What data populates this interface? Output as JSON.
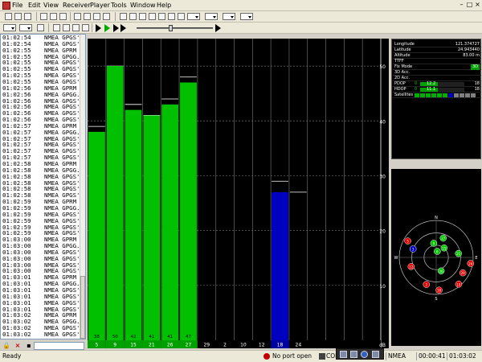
{
  "app": {
    "menu": [
      "File",
      "Edit",
      "View",
      "Receiver",
      "Player",
      "Tools",
      "Window",
      "Help"
    ],
    "window_controls": [
      "–",
      "□",
      "×"
    ]
  },
  "log": {
    "lines": [
      [
        "01:02:54",
        "NMEA GPGS'"
      ],
      [
        "01:02:54",
        "NMEA GPGS'"
      ],
      [
        "01:02:55",
        "NMEA GPRM"
      ],
      [
        "01:02:55",
        "NMEA GPGG."
      ],
      [
        "01:02:55",
        "NMEA GPGS'"
      ],
      [
        "01:02:55",
        "NMEA GPGS'"
      ],
      [
        "01:02:55",
        "NMEA GPGS'"
      ],
      [
        "01:02:55",
        "NMEA GPGS'"
      ],
      [
        "01:02:56",
        "NMEA GPRM"
      ],
      [
        "01:02:56",
        "NMEA GPGG."
      ],
      [
        "01:02:56",
        "NMEA GPGS'"
      ],
      [
        "01:02:56",
        "NMEA GPGS'"
      ],
      [
        "01:02:56",
        "NMEA GPGS'"
      ],
      [
        "01:02:56",
        "NMEA GPGS'"
      ],
      [
        "01:02:57",
        "NMEA GPRM"
      ],
      [
        "01:02:57",
        "NMEA GPGG."
      ],
      [
        "01:02:57",
        "NMEA GPGS'"
      ],
      [
        "01:02:57",
        "NMEA GPGS'"
      ],
      [
        "01:02:57",
        "NMEA GPGS'"
      ],
      [
        "01:02:57",
        "NMEA GPGS'"
      ],
      [
        "01:02:58",
        "NMEA GPRM"
      ],
      [
        "01:02:58",
        "NMEA GPGG."
      ],
      [
        "01:02:58",
        "NMEA GPGS'"
      ],
      [
        "01:02:58",
        "NMEA GPGS'"
      ],
      [
        "01:02:58",
        "NMEA GPGS'"
      ],
      [
        "01:02:58",
        "NMEA GPGS'"
      ],
      [
        "01:02:59",
        "NMEA GPRM"
      ],
      [
        "01:02:59",
        "NMEA GPGG."
      ],
      [
        "01:02:59",
        "NMEA GPGS'"
      ],
      [
        "01:02:59",
        "NMEA GPGS'"
      ],
      [
        "01:02:59",
        "NMEA GPGS'"
      ],
      [
        "01:02:59",
        "NMEA GPGS'"
      ],
      [
        "01:03:00",
        "NMEA GPRM"
      ],
      [
        "01:03:00",
        "NMEA GPGG."
      ],
      [
        "01:03:00",
        "NMEA GPGS'"
      ],
      [
        "01:03:00",
        "NMEA GPGS'"
      ],
      [
        "01:03:00",
        "NMEA GPGS'"
      ],
      [
        "01:03:00",
        "NMEA GPGS'"
      ],
      [
        "01:03:01",
        "NMEA GPRM"
      ],
      [
        "01:03:01",
        "NMEA GPGG."
      ],
      [
        "01:03:01",
        "NMEA GPGS'"
      ],
      [
        "01:03:01",
        "NMEA GPGS'"
      ],
      [
        "01:03:01",
        "NMEA GPGS'"
      ],
      [
        "01:03:01",
        "NMEA GPGS'"
      ],
      [
        "01:03:02",
        "NMEA GPRM"
      ],
      [
        "01:03:02",
        "NMEA GPGG."
      ],
      [
        "01:03:02",
        "NMEA GPGS'"
      ],
      [
        "01:03:02",
        "NMEA GPGS'"
      ]
    ]
  },
  "chart_data": {
    "type": "bar",
    "ylabel": "dB",
    "ylim": [
      0,
      55
    ],
    "yticks": [
      10,
      20,
      30,
      40,
      50
    ],
    "categories": [
      "5",
      "9",
      "15",
      "21",
      "26",
      "27",
      "29",
      "2",
      "10",
      "12",
      "18",
      "24",
      "",
      "",
      "",
      ""
    ],
    "values": [
      38,
      50,
      42,
      41,
      43,
      47,
      null,
      null,
      null,
      null,
      27,
      null,
      null,
      null,
      null,
      null
    ],
    "peaks": [
      39,
      50,
      43,
      41,
      44,
      48,
      null,
      null,
      null,
      null,
      29,
      27,
      null,
      null,
      null,
      null
    ],
    "value_labels": [
      "38",
      "50",
      "42",
      "41",
      "41",
      "47",
      "",
      "",
      "",
      "",
      "",
      "",
      "",
      "",
      "",
      ""
    ],
    "colors": {
      "used": "#00c000",
      "tracked": "#0000c0",
      "grid": "#6a6a6a",
      "axis_text": "#ffffff"
    },
    "in_use": [
      true,
      true,
      true,
      true,
      true,
      true,
      false,
      false,
      false,
      false,
      false,
      false,
      false,
      false,
      false,
      false
    ]
  },
  "info": {
    "rows": [
      {
        "label": "Longitude",
        "value": "121.374727"
      },
      {
        "label": "Latitude",
        "value": "24.943440"
      },
      {
        "label": "Altitude",
        "value": "83.00 m"
      },
      {
        "label": "TTFF",
        "value": ""
      },
      {
        "label": "Fix Mode",
        "value": "3D"
      },
      {
        "label": "3D Acc.",
        "value": ""
      },
      {
        "label": "2D Acc.",
        "value": ""
      },
      {
        "label": "PDOP",
        "value": "18",
        "bar_left": "0",
        "bar_mid": "12.2"
      },
      {
        "label": "HDOP",
        "value": "18",
        "bar_left": "0",
        "bar_mid": "11.1"
      },
      {
        "label": "Satellites",
        "value": ""
      }
    ],
    "sat_strip_colors": [
      "#00b000",
      "#00b000",
      "#00b000",
      "#00b000",
      "#00b000",
      "#00b000",
      "#0000c0",
      "#808080",
      "#808080",
      "#808080",
      "#808080"
    ]
  },
  "sky": {
    "cardinal": {
      "n": "N",
      "e": "E",
      "s": "S",
      "w": "W"
    },
    "satellites": [
      {
        "id": "5",
        "color": "#e00000"
      },
      {
        "id": "9",
        "color": "#00c000"
      },
      {
        "id": "15",
        "color": "#00c000"
      },
      {
        "id": "21",
        "color": "#00c000"
      },
      {
        "id": "26",
        "color": "#00c000"
      },
      {
        "id": "27",
        "color": "#00c000"
      },
      {
        "id": "29",
        "color": "#e00000"
      },
      {
        "id": "2",
        "color": "#e00000"
      },
      {
        "id": "10",
        "color": "#e00000"
      },
      {
        "id": "12",
        "color": "#e00000"
      },
      {
        "id": "18",
        "color": "#e00000"
      },
      {
        "id": "24",
        "color": "#e00000"
      },
      {
        "id": "6",
        "color": "#00c000"
      },
      {
        "id": "3",
        "color": "#0000c0"
      }
    ]
  },
  "status": {
    "ready": "Ready",
    "port": "No port open",
    "com": "COM",
    "mode": "NMEA",
    "elapsed": "00:00:41",
    "clock": "01:03:02"
  }
}
